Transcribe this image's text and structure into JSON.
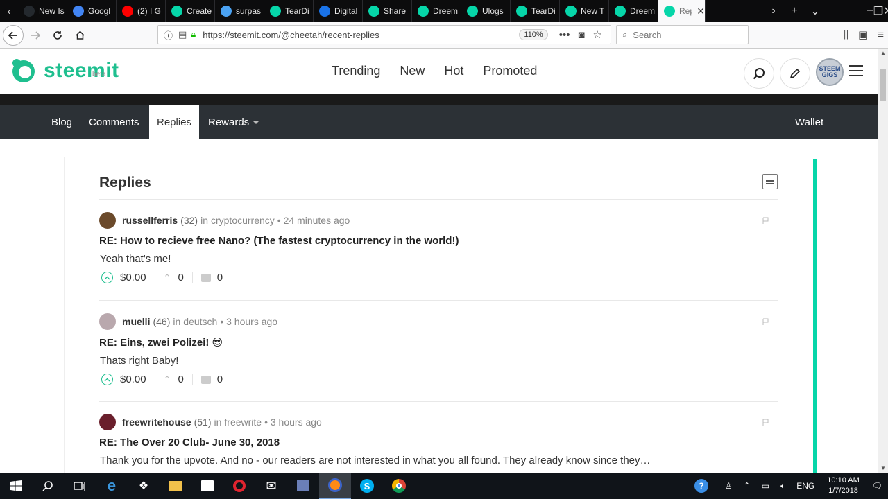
{
  "browser": {
    "tabs": [
      {
        "label": "New Is",
        "icon": "github-icon",
        "color": "#24292e"
      },
      {
        "label": "Googl",
        "icon": "google-icon",
        "color": "#4285f4"
      },
      {
        "label": "(2) I G",
        "icon": "youtube-icon",
        "color": "#ff0000"
      },
      {
        "label": "Create",
        "icon": "steemit-icon",
        "color": "#06d6a9"
      },
      {
        "label": "surpas",
        "icon": "steem-icon",
        "color": "#4ba2f2"
      },
      {
        "label": "TearDi",
        "icon": "steemit-icon",
        "color": "#06d6a9"
      },
      {
        "label": "Digital",
        "icon": "digital-icon",
        "color": "#1a73e8"
      },
      {
        "label": "Share",
        "icon": "steemit-icon",
        "color": "#06d6a9"
      },
      {
        "label": "Dreem",
        "icon": "steemit-icon",
        "color": "#06d6a9"
      },
      {
        "label": "Ulogs",
        "icon": "steemit-icon",
        "color": "#06d6a9"
      },
      {
        "label": "TearDi",
        "icon": "steemit-icon",
        "color": "#06d6a9"
      },
      {
        "label": "New T",
        "icon": "steemit-icon",
        "color": "#06d6a9"
      },
      {
        "label": "Dreem",
        "icon": "steemit-icon",
        "color": "#06d6a9"
      }
    ],
    "active_tab": {
      "label": "Rep",
      "icon": "steemit-icon"
    },
    "url": "https://steemit.com/@cheetah/recent-replies",
    "zoom": "110%",
    "search_placeholder": "Search"
  },
  "site": {
    "logo_text": "steemit",
    "logo_beta": "beta",
    "brand_color": "#1fbf8f",
    "nav": [
      "Trending",
      "New",
      "Hot",
      "Promoted"
    ],
    "avatar_line1": "STEEM",
    "avatar_line2": "GIGS"
  },
  "user_nav": {
    "items": [
      "Blog",
      "Comments",
      "Replies",
      "Rewards"
    ],
    "active": "Replies",
    "wallet": "Wallet"
  },
  "page": {
    "title": "Replies"
  },
  "replies": [
    {
      "author": "russellferris",
      "rep": "(32)",
      "category_prefix": "in",
      "category": "cryptocurrency",
      "time": "• 24 minutes ago",
      "title": "RE: How to recieve free Nano? (The fastest cryptocurrency in the world!)",
      "body": "Yeah that's me!",
      "payout": "$0.00",
      "votes": "0",
      "comments": "0",
      "avatar_color": "#6b4a2b"
    },
    {
      "author": "muelli",
      "rep": "(46)",
      "category_prefix": "in",
      "category": "deutsch",
      "time": "• 3 hours ago",
      "title": "RE: Eins, zwei Polizei! 😎",
      "body": "Thats right Baby!",
      "payout": "$0.00",
      "votes": "0",
      "comments": "0",
      "avatar_color": "#b9a8ad"
    },
    {
      "author": "freewritehouse",
      "rep": "(51)",
      "category_prefix": "in",
      "category": "freewrite",
      "time": "• 3 hours ago",
      "title": "RE: The Over 20 Club- June 30, 2018",
      "body": "Thank you for the upvote. And no - our readers are not interested in what you all found. They already know since they…",
      "payout": "",
      "votes": "",
      "comments": "",
      "avatar_color": "#6a1f2c"
    }
  ],
  "taskbar": {
    "language": "ENG",
    "time": "10:10 AM",
    "date": "1/7/2018"
  }
}
